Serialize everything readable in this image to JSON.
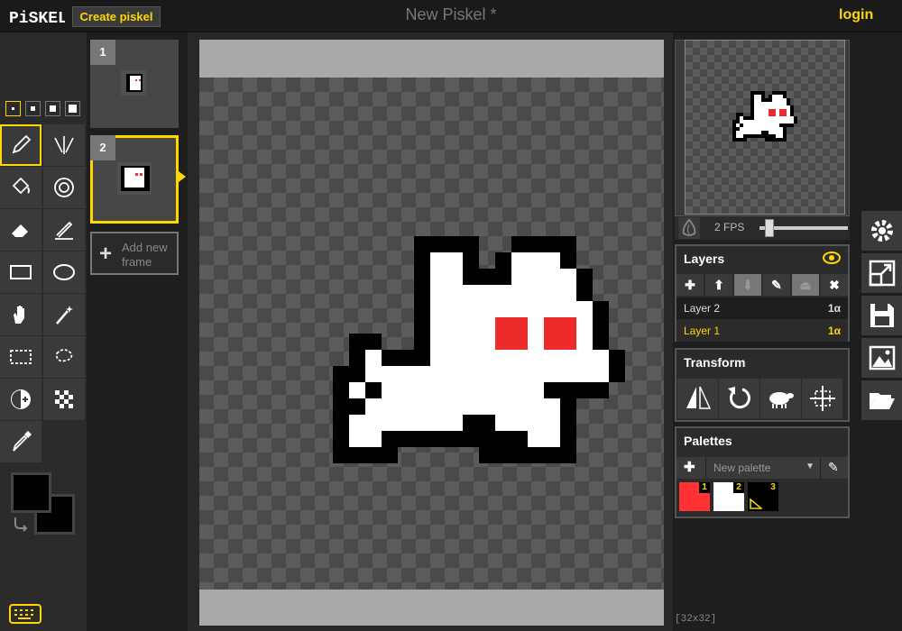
{
  "header": {
    "logo_text": "PiSKEL",
    "create_label": "Create piskel",
    "title": "New Piskel *",
    "login_label": "login"
  },
  "tools": {
    "pen_sizes": [
      1,
      2,
      3,
      4
    ],
    "items": [
      "pen-tool",
      "vertical-mirror-pen-tool",
      "paint-bucket-tool",
      "paint-same-color-tool",
      "eraser-tool",
      "stroke-tool",
      "rectangle-tool",
      "circle-tool",
      "move-tool",
      "shape-selection-tool",
      "rectangle-selection-tool",
      "lasso-selection-tool",
      "lighten-tool",
      "dithering-tool",
      "color-picker-tool"
    ],
    "primary_color": "#000000",
    "secondary_color": "#000000"
  },
  "frames": {
    "items": [
      {
        "number": "1"
      },
      {
        "number": "2"
      }
    ],
    "add_label_line1": "Add new",
    "add_label_line2": "frame"
  },
  "canvas": {
    "dimensions": "[32x32]"
  },
  "preview": {
    "fps_label": "2 FPS",
    "fps_value": 2
  },
  "layers": {
    "title": "Layers",
    "rows": [
      {
        "name": "Layer 2",
        "opacity": "1α"
      },
      {
        "name": "Layer 1",
        "opacity": "1α"
      }
    ],
    "selected_color": "#ffd700"
  },
  "transform": {
    "title": "Transform"
  },
  "palettes": {
    "title": "Palettes",
    "select_value": "New palette",
    "swatches": [
      {
        "number": "1",
        "color": "#ff3333"
      },
      {
        "number": "2",
        "color": "#ffffff"
      },
      {
        "number": "3",
        "color": "#000000"
      }
    ]
  },
  "accent_color": "#ffd700"
}
